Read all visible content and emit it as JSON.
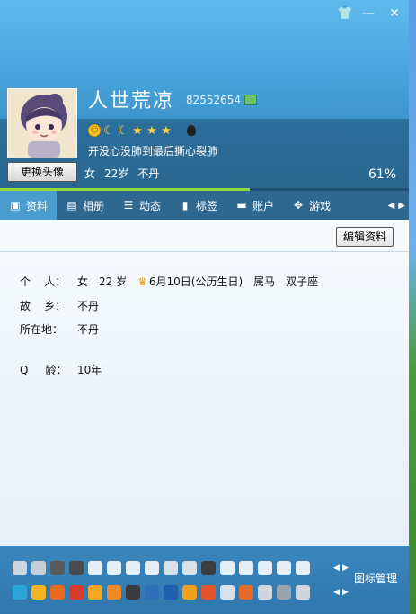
{
  "window": {
    "controls": [
      {
        "name": "skin-icon",
        "glyph": "👕"
      },
      {
        "name": "minimize-icon",
        "glyph": "—"
      },
      {
        "name": "close-icon",
        "glyph": "✕"
      }
    ]
  },
  "profile": {
    "nickname": "人世荒凉",
    "qq_number": "82552654",
    "signature": "开没心没肺到最后撕心裂肺",
    "gender": "女",
    "age": "22岁",
    "location": "不丹",
    "change_avatar_label": "更换头像",
    "level_percent_text": "61%",
    "level_progress": 0.61,
    "level_icons": [
      "sun",
      "moon",
      "moon",
      "star",
      "star",
      "star"
    ]
  },
  "tabs": [
    {
      "label": "资料",
      "icon": "profile-card-icon",
      "glyph": "▣"
    },
    {
      "label": "相册",
      "icon": "album-icon",
      "glyph": "▤"
    },
    {
      "label": "动态",
      "icon": "feed-icon",
      "glyph": "☰"
    },
    {
      "label": "标签",
      "icon": "bookmark-icon",
      "glyph": "▮"
    },
    {
      "label": "账户",
      "icon": "wallet-icon",
      "glyph": "▬"
    },
    {
      "label": "游戏",
      "icon": "game-icon",
      "glyph": "✥"
    }
  ],
  "content": {
    "edit_button_label": "编辑资料",
    "rows": [
      {
        "label": "个    人：",
        "values": [
          "女",
          "22 岁",
          "6月10日(公历生日)",
          "属马",
          "双子座"
        ]
      },
      {
        "label": "故    乡：",
        "values": [
          "不丹"
        ]
      },
      {
        "label": "所在地：",
        "values": [
          "不丹"
        ]
      },
      {
        "label": "Q     龄：",
        "values": [
          "10年"
        ]
      }
    ]
  },
  "bottom_bar": {
    "manage_label": "图标管理",
    "row1_colors": [
      "#cfd6de",
      "#c7ced6",
      "#5a5a5a",
      "#4b4b4b",
      "#e6eef6",
      "#e6eef6",
      "#e6eef6",
      "#e6eef6",
      "#d8e0e8",
      "#d8e0e8",
      "#3c3c3c",
      "#e6eef6",
      "#e6eef6",
      "#e6eef6",
      "#e6eef6",
      "#e6eef6"
    ],
    "row2_colors": [
      "#2aa6d9",
      "#f5b321",
      "#e86a1c",
      "#d63a2a",
      "#f2a623",
      "#f08a22",
      "#3a3a3a",
      "#2f6fb5",
      "#1f5fb0",
      "#f0a020",
      "#e6542c",
      "#d8e0e8",
      "#e66a2a",
      "#cfd6de",
      "#9aa4ad",
      "#cfd6de"
    ]
  }
}
